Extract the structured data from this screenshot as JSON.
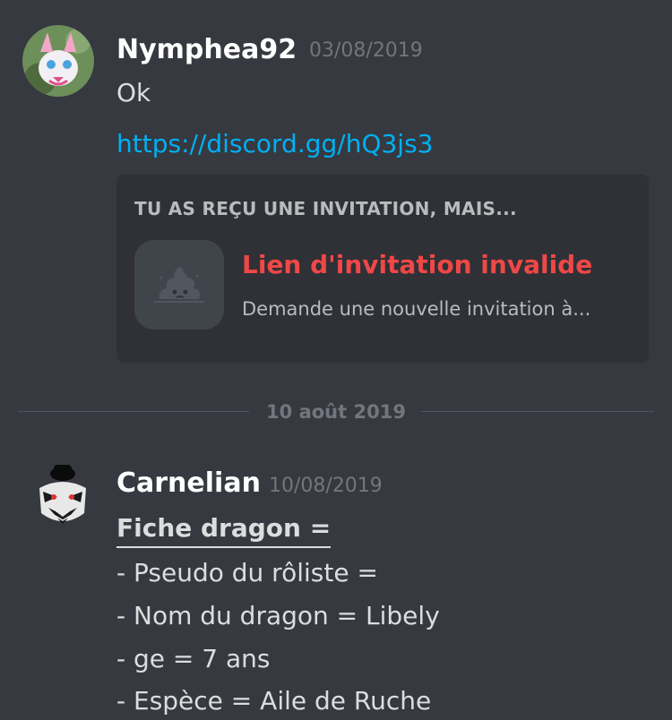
{
  "messages": [
    {
      "username": "Nymphea92",
      "timestamp": "03/08/2019",
      "text": "Ok",
      "link": "https://discord.gg/hQ3js3",
      "embed": {
        "header": "TU AS REÇU UNE INVITATION, MAIS...",
        "title": "Lien d'invitation invalide",
        "subtitle": "Demande une nouvelle invitation à..."
      }
    },
    {
      "username": "Carnelian",
      "timestamp": "10/08/2019",
      "title": "Fiche dragon =",
      "lines": [
        "- Pseudo du rôliste =",
        "- Nom du dragon = Libely",
        "-  ge = 7 ans",
        "- Espèce = Aile de Ruche"
      ]
    }
  ],
  "date_divider": "10 août 2019",
  "colors": {
    "background": "#36393f",
    "embed_bg": "#2f3136",
    "link": "#00b0f4",
    "error": "#f04747",
    "timestamp": "#72767d"
  }
}
